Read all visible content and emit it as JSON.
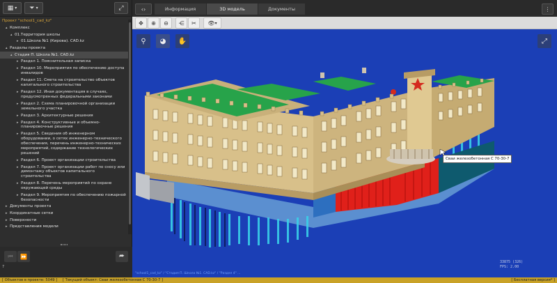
{
  "left_toolbar": {
    "building_icon": "building-icon",
    "filter_icon": "filter-icon",
    "expand_icon": "expand-icon"
  },
  "tree": [
    {
      "label": "Проект \"school1_cad_kz\"",
      "indent": 0,
      "arrow": "",
      "color": "#d9a53a"
    },
    {
      "label": "Комплекс",
      "indent": 1,
      "arrow": "▴",
      "color": "#e0e0e0"
    },
    {
      "label": "01.Территория школы",
      "indent": 2,
      "arrow": "▴",
      "color": "#e0e0e0"
    },
    {
      "label": "01.Школа №1 (Кирова). CAD.kz",
      "indent": 3,
      "arrow": "▸",
      "color": "#e0e0e0"
    },
    {
      "label": "Разделы проекта",
      "indent": 1,
      "arrow": "▴",
      "color": "#e0e0e0"
    },
    {
      "label": "Стадия П. Школа №1. CAD.kz",
      "indent": 2,
      "arrow": "▴",
      "color": "#e0e0e0",
      "selected": true
    },
    {
      "label": "Раздел 1. Пояснительная записка",
      "indent": 3,
      "arrow": "▸",
      "color": "#e0e0e0"
    },
    {
      "label": "Раздел 10. Мероприятия по обеспечению доступа инвалидов",
      "indent": 3,
      "arrow": "▸",
      "color": "#e0e0e0"
    },
    {
      "label": "Раздел 11. Смета на строительство объектов капитального строительства",
      "indent": 3,
      "arrow": "▸",
      "color": "#e0e0e0"
    },
    {
      "label": "Раздел 12. Иная документация в случаях, предусмотренных федеральными законами",
      "indent": 3,
      "arrow": "▸",
      "color": "#e0e0e0"
    },
    {
      "label": "Раздел 2. Схема планировочной организации земельного участка",
      "indent": 3,
      "arrow": "▸",
      "color": "#e0e0e0"
    },
    {
      "label": "Раздел 3. Архитектурные решения",
      "indent": 3,
      "arrow": "▸",
      "color": "#e0e0e0"
    },
    {
      "label": "Раздел 4. Конструктивные и объемно-планировочные решения",
      "indent": 3,
      "arrow": "▸",
      "color": "#e0e0e0"
    },
    {
      "label": "Раздел 5. Сведения об инженерном оборудовании, о сетях инженерно-технического обеспечения, перечень инженерно-технических мероприятий, содержание технологических решений",
      "indent": 3,
      "arrow": "▸",
      "color": "#e0e0e0"
    },
    {
      "label": "Раздел 6. Проект организации строительства",
      "indent": 3,
      "arrow": "▸",
      "color": "#e0e0e0"
    },
    {
      "label": "Раздел 7. Проект организации работ по сносу или демонтажу объектов капитального строительства",
      "indent": 3,
      "arrow": "▸",
      "color": "#e0e0e0"
    },
    {
      "label": "Раздел 8. Перечень мероприятий по охране окружающей среды",
      "indent": 3,
      "arrow": "▸",
      "color": "#e0e0e0"
    },
    {
      "label": "Раздел 9. Мероприятия по обеспечению пожарной безопасности",
      "indent": 3,
      "arrow": "▸",
      "color": "#e0e0e0"
    },
    {
      "label": "Документы проекта",
      "indent": 1,
      "arrow": "▸",
      "color": "#e0e0e0"
    },
    {
      "label": "Координатные сетки",
      "indent": 1,
      "arrow": "▸",
      "color": "#e0e0e0"
    },
    {
      "label": "Поверхности",
      "indent": 1,
      "arrow": "▸",
      "color": "#e0e0e0"
    },
    {
      "label": "Представления модели",
      "indent": 1,
      "arrow": "▸",
      "color": "#e0e0e0"
    }
  ],
  "bottom_panel": {
    "counter": "7"
  },
  "tabs": [
    {
      "label": "Информация",
      "active": false
    },
    {
      "label": "3D модель",
      "active": true
    },
    {
      "label": "Документы",
      "active": false
    }
  ],
  "toolbar_icons": [
    "move-icon",
    "zoom-in-icon",
    "zoom-out-icon",
    "share-icon",
    "cut-icon",
    "eye-icon",
    "chevron-down-icon"
  ],
  "tooltip": "Сваи железобетонная С 70-30-7",
  "stats": {
    "line1": "33875 (326)",
    "line2": "FPS: 2.00"
  },
  "viewport_footer": "\"school1_cad_kz\" / \"Стадия П. Школа №1. CAD.kz\" / \"Раздел 4\" ...",
  "status": {
    "objects": "[ Объектов в проекте: 5049 ]",
    "current": "[ Текущий объект: Сваи железобетонная С 70-30-7 ]",
    "license": "[ Бесплатная версия* ]"
  },
  "colors": {
    "viewport_bg": "#1b3fb6",
    "status_bar": "#c9a227",
    "facade": "#d8c08a",
    "roof": "#27a34a",
    "piles_red": "#e0201a",
    "piles_cyan": "#3ad0e8"
  }
}
